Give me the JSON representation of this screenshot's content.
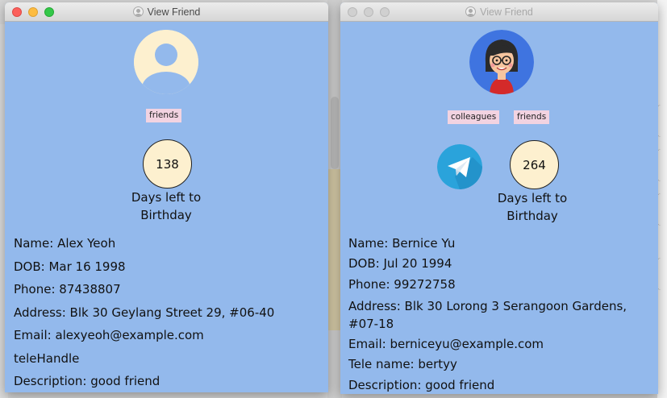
{
  "colors": {
    "window_bg": "#93b9ec",
    "tag_bg": "#f2d3e1",
    "birthday_bg": "#fdf0cf",
    "telegram": "#2aa3db"
  },
  "windows": [
    {
      "title": "View Friend",
      "active": true,
      "avatar": "default-avatar-icon",
      "tags": [
        "friends"
      ],
      "birthday": {
        "days": "138",
        "label_line1": "Days left to",
        "label_line2": "Birthday"
      },
      "telegram_icon": false,
      "name": "Name: Alex Yeoh",
      "dob": "DOB: Mar 16 1998",
      "phone": "Phone: 87438807",
      "address": "Address: Blk 30 Geylang Street 29, #06-40",
      "email": "Email: alexyeoh@example.com",
      "tele": "teleHandle",
      "description": "Description: good friend"
    },
    {
      "title": "View Friend",
      "active": false,
      "avatar": "girl-avatar-icon",
      "tags": [
        "colleagues",
        "friends"
      ],
      "birthday": {
        "days": "264",
        "label_line1": "Days left to",
        "label_line2": "Birthday"
      },
      "telegram_icon": true,
      "name": "Name: Bernice Yu",
      "dob": "DOB: Jul 20 1994",
      "phone": "Phone: 99272758",
      "address": "Address: Blk 30 Lorong 3 Serangoon Gardens, #07-18",
      "email": "Email: berniceyu@example.com",
      "tele": "Tele name: bertyy",
      "description": "Description: good friend"
    }
  ]
}
